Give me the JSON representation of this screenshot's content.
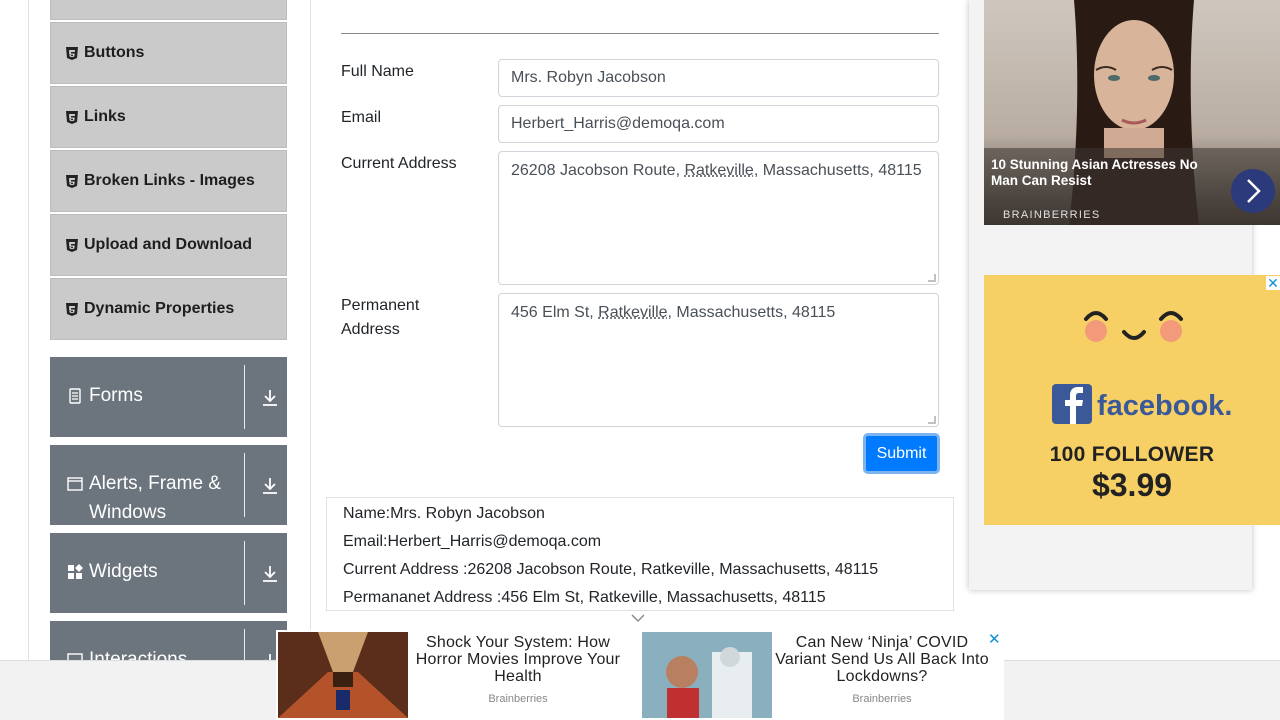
{
  "sidebar": {
    "elements_items": [
      {
        "label": "Buttons"
      },
      {
        "label": "Links"
      },
      {
        "label": "Broken Links - Images"
      },
      {
        "label": "Upload and Download"
      },
      {
        "label": "Dynamic Properties"
      }
    ],
    "groups": [
      {
        "label": "Forms",
        "icon": "document-icon"
      },
      {
        "label": "Alerts, Frame & Windows",
        "icon": "window-icon"
      },
      {
        "label": "Widgets",
        "icon": "widgets-icon"
      },
      {
        "label": "Interactions",
        "icon": "interactions-icon"
      }
    ]
  },
  "form": {
    "full_name_label": "Full Name",
    "full_name_value": "Mrs. Robyn Jacobson",
    "email_label": "Email",
    "email_value": "Herbert_Harris@demoqa.com",
    "current_address_label": "Current Address",
    "current_address_pre": "26208 Jacobson Route, ",
    "current_address_city": "Ratkeville",
    "current_address_post": ", Massachusetts, 48115",
    "permanent_address_label_1": "Permanent",
    "permanent_address_label_2": "Address",
    "permanent_address_pre": "456 Elm St, ",
    "permanent_address_city": "Ratkeville",
    "permanent_address_post": ", Massachusetts, 48115",
    "submit_label": "Submit"
  },
  "output": {
    "name": "Name:Mrs. Robyn Jacobson",
    "email": "Email:Herbert_Harris@demoqa.com",
    "current_address": "Current Address :26208 Jacobson Route, Ratkeville, Massachusetts, 48115",
    "permanent_address": "Permananet Address :456 Elm St, Ratkeville, Massachusetts, 48115"
  },
  "ads": {
    "ad1_title": "10 Stunning Asian Actresses No Man Can Resist",
    "ad1_brand": "BRAINBERRIES",
    "ad2_brand": "facebook.",
    "ad2_line1": "100 FOLLOWER",
    "ad2_line2": "$3.99",
    "bottom_1_title": "Shock Your System: How Horror Movies Improve Your Health",
    "bottom_1_brand": "Brainberries",
    "bottom_2_title": "Can New ‘Ninja’ COVID Variant Send Us All Back Into Lockdowns?",
    "bottom_2_brand": "Brainberries",
    "close_glyph": "✕"
  },
  "colors": {
    "accent": "#007bff",
    "sidebar_group": "#6c757d",
    "sidebar_item": "#cacaca",
    "ad_yellow": "#f6d064",
    "facebook_blue": "#3b5998"
  }
}
